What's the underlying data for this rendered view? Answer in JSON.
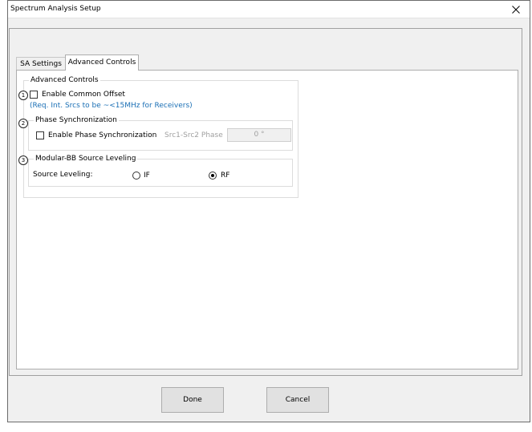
{
  "window": {
    "title": "Spectrum Analysis Setup",
    "close_glyph": "✕"
  },
  "tabs": [
    {
      "label": "SA Settings",
      "active": false
    },
    {
      "label": "Advanced Controls",
      "active": true
    }
  ],
  "advanced_controls": {
    "group_title": "Advanced Controls",
    "common_offset": {
      "marker": "1",
      "label": "Enable Common Offset",
      "checked": false,
      "note": "(Req. Int. Srcs to be ~<15MHz for Receivers)"
    },
    "phase_sync": {
      "marker": "2",
      "group_title": "Phase Synchronization",
      "checkbox_label": "Enable Phase Synchronization",
      "checked": false,
      "phase_label": "Src1-Src2 Phase",
      "phase_value": "0 °"
    },
    "source_leveling": {
      "marker": "3",
      "group_title": "Modular-BB Source Leveling",
      "label": "Source Leveling:",
      "options": [
        {
          "label": "IF",
          "selected": false
        },
        {
          "label": "RF",
          "selected": true
        }
      ]
    }
  },
  "footer": {
    "done_label": "Done",
    "cancel_label": "Cancel"
  },
  "icons": {
    "close": "close-icon"
  }
}
